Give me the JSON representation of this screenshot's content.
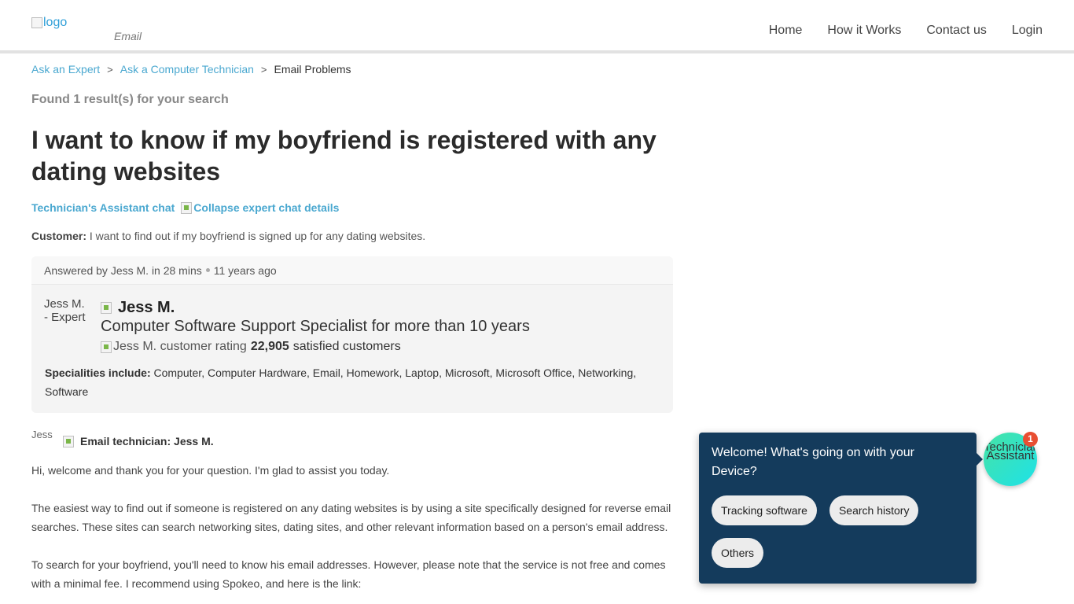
{
  "header": {
    "logo_alt": "logo",
    "logo_sub": "Email",
    "nav": [
      "Home",
      "How it Works",
      "Contact us",
      "Login"
    ]
  },
  "breadcrumb": {
    "items": [
      "Ask an Expert",
      "Ask a Computer Technician"
    ],
    "current": "Email Problems",
    "separator": ">"
  },
  "search": {
    "found_text": "Found 1 result(s) for your search"
  },
  "question": {
    "title": "I want to know if my boyfriend is registered with any dating websites",
    "chat_link": "Technician's Assistant chat",
    "collapse_link": "Collapse expert chat details",
    "customer_label": "Customer:",
    "customer_text": "I want to find out if my boyfriend is signed up for any dating websites."
  },
  "answer_card": {
    "answered_by": "Answered by Jess M. in 28 mins",
    "time_ago": "11 years ago",
    "avatar_alt": "Jess M. - Expert",
    "expert_name": "Jess M.",
    "expert_title": "Computer Software Support Specialist for more than 10 years",
    "rating_alt": "Jess M. customer rating",
    "customer_count": "22,905",
    "customer_suffix": "satisfied customers",
    "specialities_label": "Specialities include:",
    "specialities": "Computer, Computer Hardware, Email, Homework, Laptop, Microsoft, Microsoft Office, Networking, Software"
  },
  "response": {
    "avatar_alt": "Jess",
    "label": "Email technician: Jess M.",
    "paragraphs": [
      "Hi, welcome and thank you for your question. I'm glad to assist you today.",
      "The easiest way to find out if someone is registered on any dating websites is by using a site specifically designed for reverse email searches. These sites can search networking sites, dating sites, and other relevant information based on a person's email address.",
      "To search for your boyfriend, you'll need to know his email addresses. However, please note that the service is not free and comes with a minimal fee. I recommend using Spokeo, and here is the link:"
    ]
  },
  "chat_widget": {
    "message": "Welcome! What's going on with your Device?",
    "options": [
      "Tracking software",
      "Search history",
      "Others"
    ],
    "bubble_alt": "Technician's Assistant",
    "badge": "1"
  },
  "colors": {
    "link": "#4aa8d0",
    "widget_bg": "#143b5c",
    "badge": "#e84e32"
  }
}
